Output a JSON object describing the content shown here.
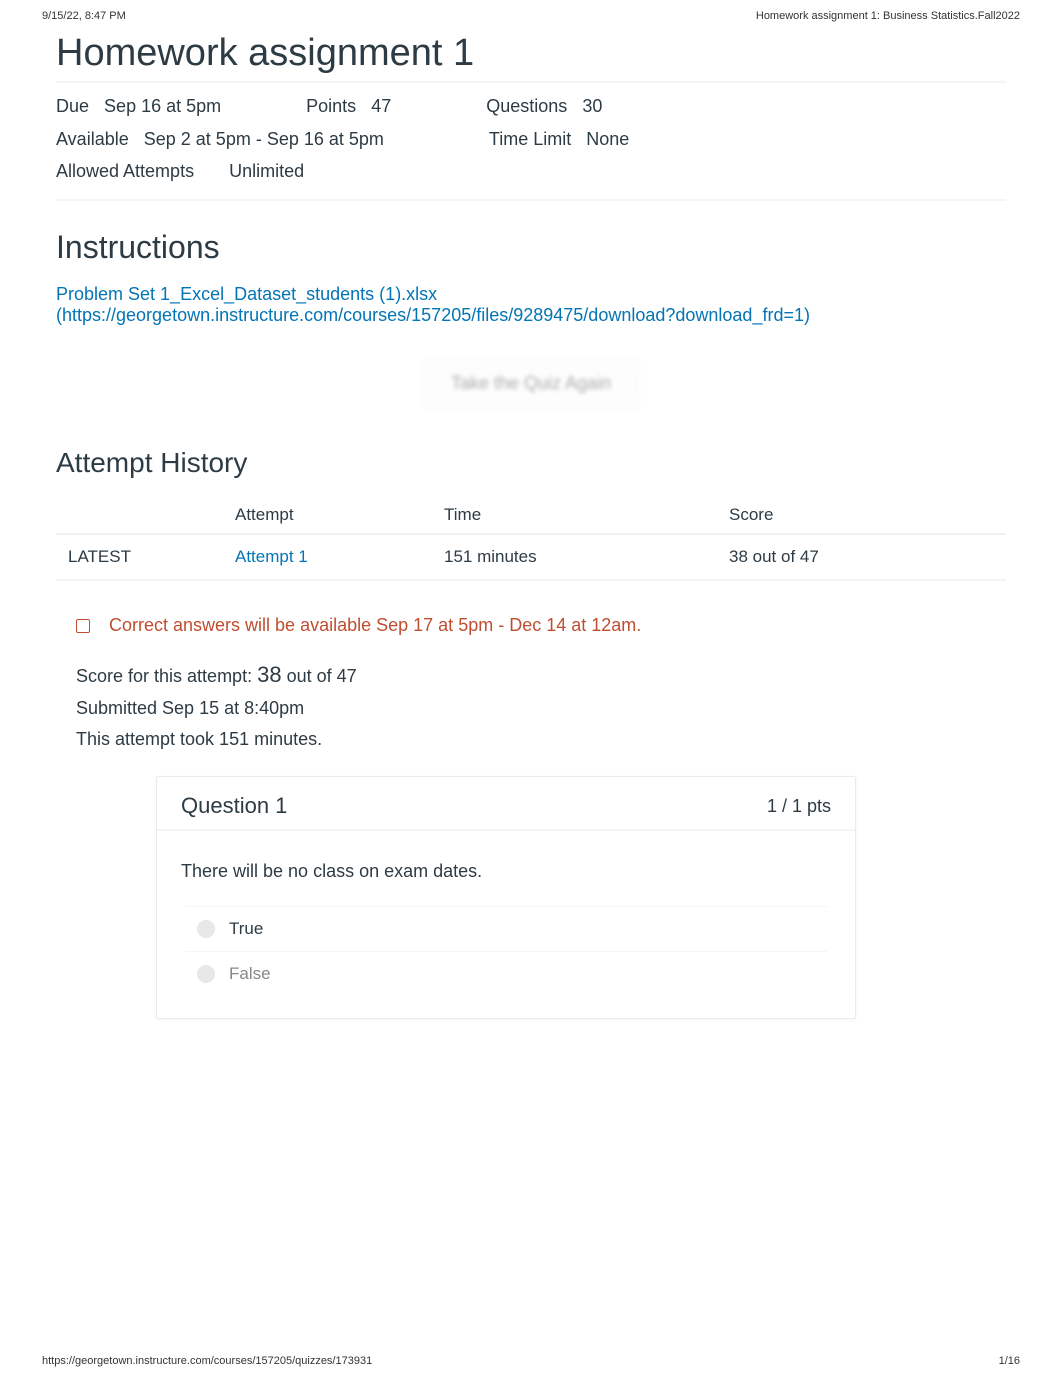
{
  "print": {
    "datetime": "9/15/22, 8:47 PM",
    "doc_title": "Homework assignment 1: Business Statistics.Fall2022",
    "footer_url": "https://georgetown.instructure.com/courses/157205/quizzes/173931",
    "page_num": "1/16"
  },
  "title": "Homework assignment 1",
  "meta": {
    "due_label": "Due",
    "due_value": "Sep 16 at 5pm",
    "points_label": "Points",
    "points_value": "47",
    "questions_label": "Questions",
    "questions_value": "30",
    "available_label": "Available",
    "available_value": "Sep 2 at 5pm - Sep 16 at 5pm",
    "timelimit_label": "Time Limit",
    "timelimit_value": "None",
    "attempts_label": "Allowed Attempts",
    "attempts_value": "Unlimited"
  },
  "instructions_heading": "Instructions",
  "file_link_text": "Problem Set 1_Excel_Dataset_students (1).xlsx",
  "file_url": "(https://georgetown.instructure.com/courses/157205/files/9289475/download?download_frd=1)",
  "take_again": "Take the Quiz Again",
  "history_heading": "Attempt History",
  "history_cols": {
    "status": "",
    "attempt": "Attempt",
    "time": "Time",
    "score": "Score"
  },
  "history_row": {
    "status": "LATEST",
    "attempt": "Attempt 1",
    "time": "151 minutes",
    "score": "38 out of 47"
  },
  "correct_answers_text": "Correct answers will be available Sep 17 at 5pm - Dec 14 at 12am.",
  "score_block": {
    "line1_label": "Score for this attempt: ",
    "line1_score": "38",
    "line1_suffix": " out of 47",
    "line2": "Submitted Sep 15 at 8:40pm",
    "line3": "This attempt took 151 minutes."
  },
  "question": {
    "title": "Question 1",
    "points": "1 / 1 pts",
    "text": "There will be no class on exam dates.",
    "true_label": "True",
    "false_label": "False"
  }
}
